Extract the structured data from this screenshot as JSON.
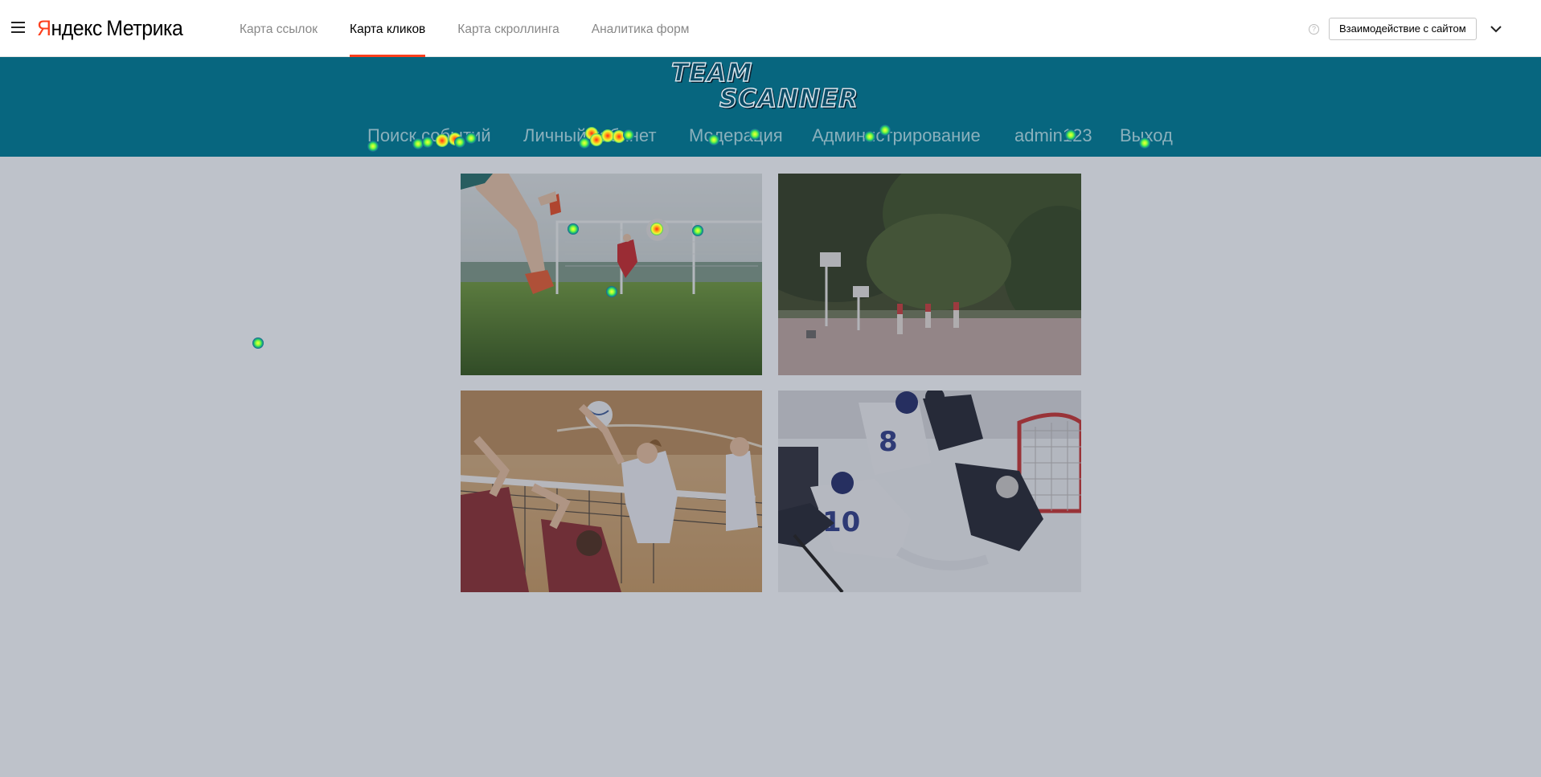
{
  "metrika": {
    "logo": {
      "brand_first_letter": "Я",
      "brand_rest": "ндекс",
      "product": "Метрика"
    },
    "menu_icon": "hamburger-icon",
    "tabs": [
      {
        "label": "Карта ссылок",
        "active": false
      },
      {
        "label": "Карта кликов",
        "active": true
      },
      {
        "label": "Карта скроллинга",
        "active": false
      },
      {
        "label": "Аналитика форм",
        "active": false
      }
    ],
    "help_icon": "question-icon",
    "help_glyph": "?",
    "mode_button_label": "Взаимодействие с сайтом",
    "dropdown_icon": "chevron-down-icon",
    "accent_color": "#fc3f1d"
  },
  "site": {
    "header_color": "#07667f",
    "logo": {
      "line1": "TEAM",
      "line2": "SCANNER"
    },
    "nav": [
      "Поиск событий",
      "Личный кабинет",
      "Модерация",
      "Администрирование",
      "admin123",
      "Выход"
    ],
    "photos": [
      {
        "subject": "football"
      },
      {
        "subject": "basketball"
      },
      {
        "subject": "volleyball"
      },
      {
        "subject": "hockey"
      }
    ],
    "heatmap_colors": [
      "#1d3a9e",
      "#18b87a",
      "#f4ff3a",
      "#ff2a1a"
    ]
  }
}
